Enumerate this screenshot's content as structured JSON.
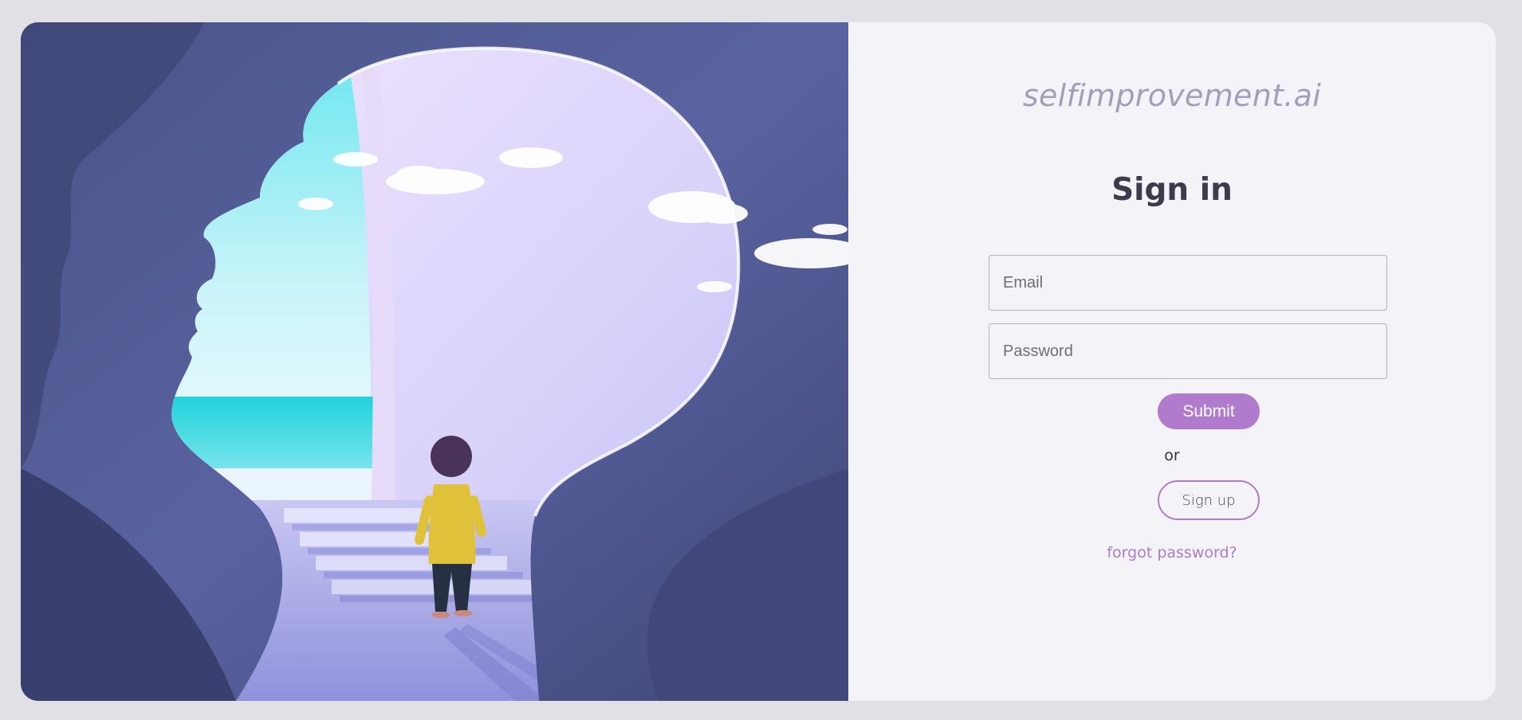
{
  "brand": {
    "name": "selfimprovement.ai"
  },
  "form": {
    "title": "Sign in",
    "email_placeholder": "Email",
    "password_placeholder": "Password",
    "submit_label": "Submit",
    "or_text": "or",
    "signup_label": "Sign up",
    "forgot_label": "forgot password?"
  },
  "colors": {
    "page_background": "#e1e0e5",
    "panel_background": "#f4f3f8",
    "accent": "#b07acd",
    "brand_text": "#a59eb9",
    "title_text": "#3c3c4c",
    "link": "#a77fc9"
  }
}
